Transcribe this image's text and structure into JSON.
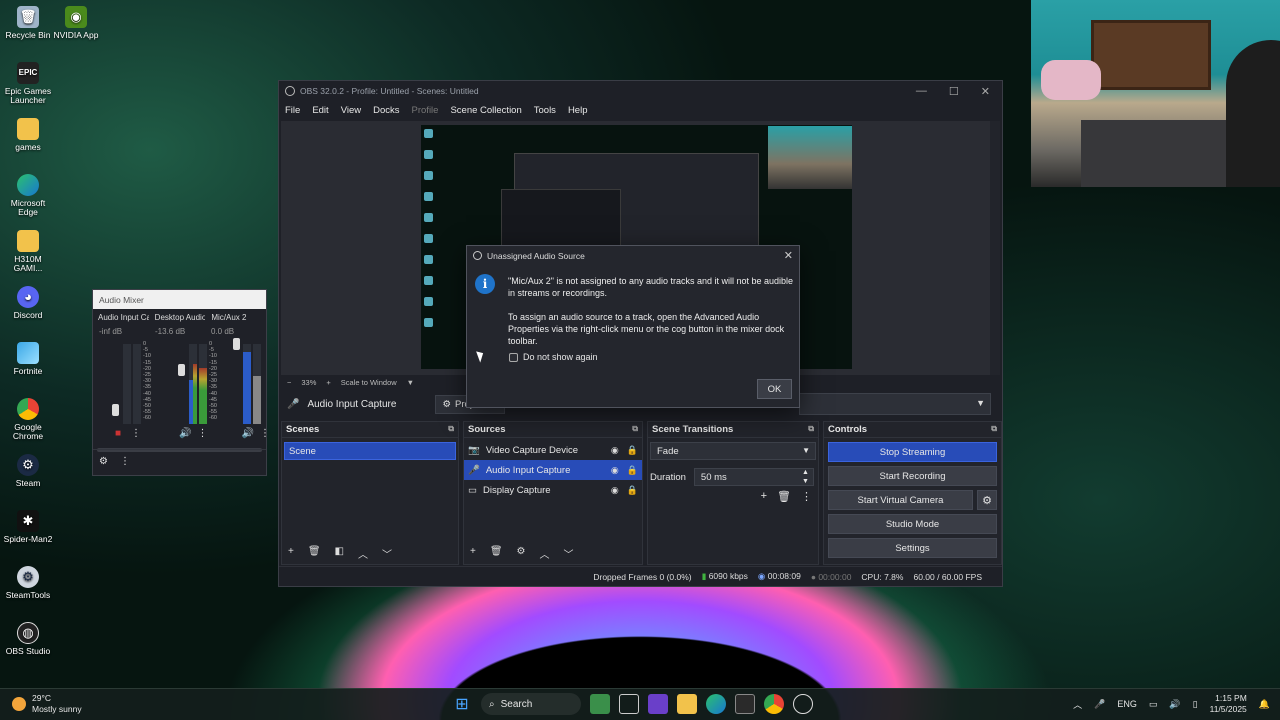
{
  "desktop": {
    "icons": [
      {
        "label": "Recycle Bin"
      },
      {
        "label": "NVIDIA App"
      },
      {
        "label": "Epic Games Launcher"
      },
      {
        "label": "games"
      },
      {
        "label": "Microsoft Edge"
      },
      {
        "label": "H310M GAMI..."
      },
      {
        "label": "Discord"
      },
      {
        "label": "Fortnite"
      },
      {
        "label": "Google Chrome"
      },
      {
        "label": "Steam"
      },
      {
        "label": "Spider-Man2"
      },
      {
        "label": "SteamTools"
      },
      {
        "label": "OBS Studio"
      }
    ]
  },
  "mixer": {
    "title": "Audio Mixer",
    "channels": [
      {
        "name": "Audio Input Captur",
        "db": "-inf dB"
      },
      {
        "name": "Desktop Audio",
        "db": "-13.6 dB"
      },
      {
        "name": "Mic/Aux 2",
        "db": "0.0 dB"
      }
    ],
    "scale": "0\n-5\n-10\n-15\n-20\n-25\n-30\n-35\n-40\n-45\n-50\n-55\n-60"
  },
  "obs": {
    "title": "OBS 32.0.2 - Profile: Untitled - Scenes: Untitled",
    "menu": [
      "File",
      "Edit",
      "View",
      "Docks",
      "Profile",
      "Scene Collection",
      "Tools",
      "Help"
    ],
    "zoom": {
      "minus": "−",
      "value": "33%",
      "plus": "+",
      "scale": "Scale to Window"
    },
    "context": {
      "source": "Audio Input Capture",
      "properties": "Properties"
    },
    "scenes": {
      "header": "Scenes",
      "items": [
        "Scene"
      ]
    },
    "sources": {
      "header": "Sources",
      "items": [
        {
          "name": "Video Capture Device"
        },
        {
          "name": "Audio Input Capture"
        },
        {
          "name": "Display Capture"
        }
      ]
    },
    "transitions": {
      "header": "Scene Transitions",
      "selected": "Fade",
      "duration_label": "Duration",
      "duration_value": "50 ms"
    },
    "controls": {
      "header": "Controls",
      "stop_streaming": "Stop Streaming",
      "start_recording": "Start Recording",
      "start_virtual_camera": "Start Virtual Camera",
      "studio_mode": "Studio Mode",
      "settings": "Settings"
    },
    "status": {
      "dropped": "Dropped Frames 0 (0.0%)",
      "kbps": "6090 kbps",
      "stream_time": "00:08:09",
      "rec_time": "00:00:00",
      "cpu": "CPU: 7.8%",
      "fps": "60.00 / 60.00 FPS"
    }
  },
  "dialog": {
    "title": "Unassigned Audio Source",
    "line1": "\"Mic/Aux 2\" is not assigned to any audio tracks and it will not be audible in streams or recordings.",
    "line2": "To assign an audio source to a track, open the Advanced Audio Properties via the right-click menu or the cog button in the mixer dock toolbar.",
    "checkbox": "Do not show again",
    "ok": "OK"
  },
  "taskbar": {
    "weather_temp": "29°C",
    "weather_desc": "Mostly sunny",
    "search": "Search",
    "lang": "ENG",
    "time": "1:15 PM",
    "date": "11/5/2025"
  },
  "colors": {
    "accent": "#284cb8",
    "bg": "#1e2027",
    "dialog_info": "#1f73c9"
  }
}
